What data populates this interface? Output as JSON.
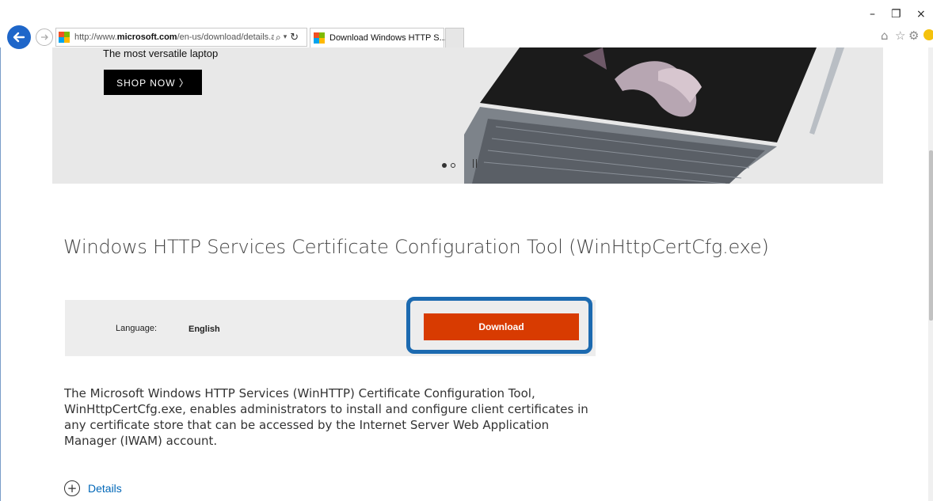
{
  "browser": {
    "url_prefix": "http://www.",
    "url_domain": "microsoft.com",
    "url_rest": "/en-us/download/details.as",
    "tab_title": "Download Windows HTTP S...",
    "tab_close": "×",
    "window_controls": {
      "minimize": "–",
      "maximize": "❐",
      "close": "×"
    },
    "icons": [
      "back-icon",
      "forward-icon",
      "search-icon",
      "refresh-icon",
      "home-icon",
      "star-icon",
      "gear-icon",
      "smiley-icon"
    ]
  },
  "hero": {
    "tagline": "The most versatile laptop",
    "shop_label": "SHOP NOW 〉",
    "carousel_slides": 2,
    "carousel_active": 1
  },
  "page": {
    "title": "Windows HTTP Services Certificate Configuration Tool (WinHttpCertCfg.exe)",
    "language_label": "Language:",
    "language_value": "English",
    "download_label": "Download",
    "description": "The Microsoft Windows HTTP Services (WinHTTP) Certificate Configuration Tool, WinHttpCertCfg.exe, enables administrators to install and configure client certificates in any certificate store that can be accessed by the Internet Server Web Application Manager (IWAM) account.",
    "details_label": "Details",
    "details_icon": "⊕"
  },
  "colors": {
    "download_button": "#d83b01",
    "highlight_outline": "#1c6ab0",
    "link": "#0067b8",
    "back_button": "#1e66c9"
  }
}
